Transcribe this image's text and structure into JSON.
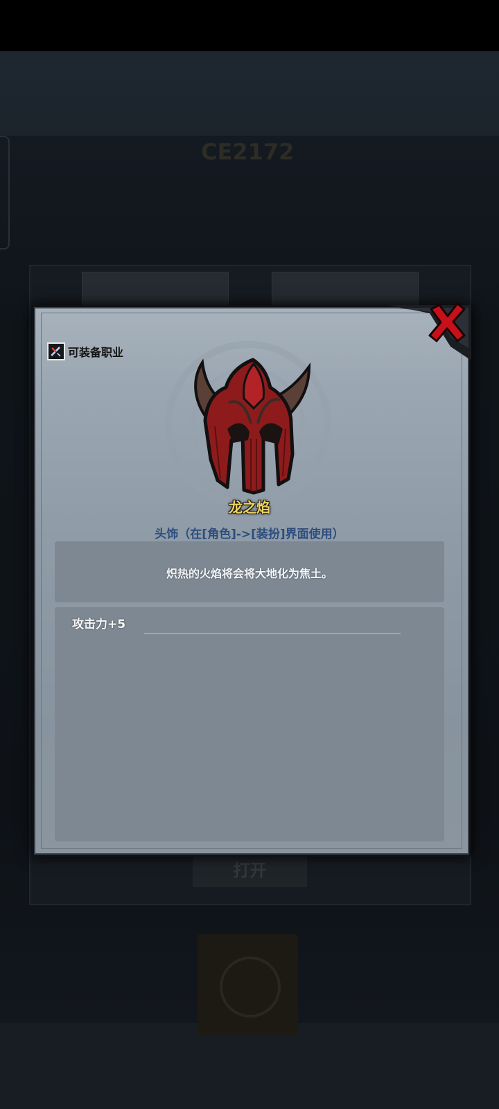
{
  "background": {
    "power_text": "CE2172",
    "action_button_label": "打开"
  },
  "dialog": {
    "job_tag_label": "可装备职业",
    "item_name": "龙之焰",
    "item_type": "头饰（在[角色]->[装扮]界面使用）",
    "description": "炽热的火焰将会将大地化为焦土。",
    "stats": [
      "攻击力+5"
    ],
    "icons": {
      "close": "close-icon",
      "job": "job-class-icon",
      "item": "dragon-helmet-icon"
    }
  },
  "colors": {
    "item_name": "#f0d35b",
    "item_type": "#2c4d7e",
    "close_x": "#c8101a"
  }
}
